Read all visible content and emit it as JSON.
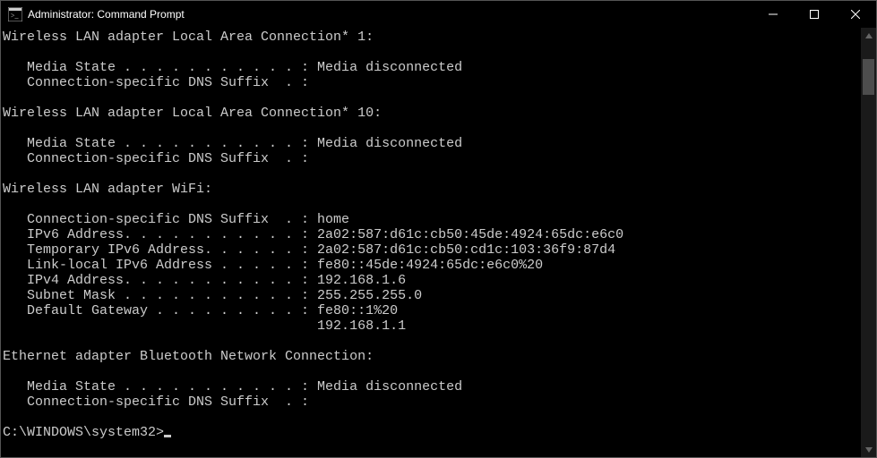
{
  "window": {
    "title": "Administrator: Command Prompt"
  },
  "terminal": {
    "lines": [
      "Wireless LAN adapter Local Area Connection* 1:",
      "",
      "   Media State . . . . . . . . . . . : Media disconnected",
      "   Connection-specific DNS Suffix  . :",
      "",
      "Wireless LAN adapter Local Area Connection* 10:",
      "",
      "   Media State . . . . . . . . . . . : Media disconnected",
      "   Connection-specific DNS Suffix  . :",
      "",
      "Wireless LAN adapter WiFi:",
      "",
      "   Connection-specific DNS Suffix  . : home",
      "   IPv6 Address. . . . . . . . . . . : 2a02:587:d61c:cb50:45de:4924:65dc:e6c0",
      "   Temporary IPv6 Address. . . . . . : 2a02:587:d61c:cb50:cd1c:103:36f9:87d4",
      "   Link-local IPv6 Address . . . . . : fe80::45de:4924:65dc:e6c0%20",
      "   IPv4 Address. . . . . . . . . . . : 192.168.1.6",
      "   Subnet Mask . . . . . . . . . . . : 255.255.255.0",
      "   Default Gateway . . . . . . . . . : fe80::1%20",
      "                                       192.168.1.1",
      "",
      "Ethernet adapter Bluetooth Network Connection:",
      "",
      "   Media State . . . . . . . . . . . : Media disconnected",
      "   Connection-specific DNS Suffix  . :",
      ""
    ],
    "prompt": "C:\\WINDOWS\\system32>"
  }
}
